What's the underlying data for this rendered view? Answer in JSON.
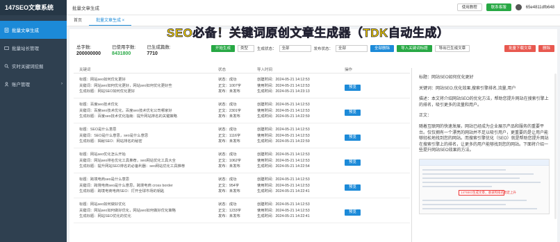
{
  "app": {
    "title": "147SEO文章系统"
  },
  "sidebar": {
    "items": [
      {
        "label": "批量文章生成",
        "active": true
      },
      {
        "label": "批量站长管理",
        "active": false
      },
      {
        "label": "实时关键词挖掘",
        "active": false
      },
      {
        "label": "账户管理",
        "active": false,
        "arrow": "›"
      }
    ]
  },
  "header": {
    "breadcrumb": "批量文章生成",
    "help_label": "使用教程",
    "service_label": "联系客服",
    "username": "65e4811dfb648"
  },
  "tabs": [
    {
      "label": "首页"
    },
    {
      "label": "批量文章生成 ×"
    }
  ],
  "banner": "SEO必备！关键词原创文章生成器（TDK自动生成）",
  "stats": {
    "total_label": "总字数:",
    "total_value": "200000000",
    "used_label": "已使用字数:",
    "used_value": "8431800",
    "generated_label": "已生成篇数:",
    "generated_value": "7710"
  },
  "toolbar": {
    "start_label": "开始生成",
    "status_label": "类型",
    "gen_status_label": "生成状态：",
    "gen_status_value": "全部",
    "pub_status_label": "发布状态：",
    "pub_status_value": "全部",
    "select_all_label": "全部删除",
    "import_label": "导入关键词标题",
    "export_label": "导出已生成文章",
    "export_red_label": "批量下载文章",
    "delete_red_label": "删除"
  },
  "table": {
    "headers": [
      "关键词",
      "状态",
      "导入时间",
      "操作"
    ],
    "op_label": "预览",
    "rows": [
      {
        "title": "标题：网站seo如何优化更好",
        "kw": "关键词：网站seo如何优化更好，网站seo如何优化更好些",
        "gen": "生成标题：网站SEO如何优化更好",
        "s1": "状态：成功",
        "s2": "正文：1007字",
        "s3": "发布：未发布",
        "t1": "创建时间：2024-05-21 14:12:53",
        "t2": "使用时间：2024-05-21 14:12:53",
        "t3": "生成时间：2024-05-21 14:23:13"
      },
      {
        "title": "标题：百度seo技术优化",
        "kw": "关键词：百度seo技术优化，百度seo技术优化公司哪家好",
        "gen": "生成标题：百度seo技术优化指南：提升网站排名的关键策略",
        "s1": "状态：成功",
        "s2": "正文：2301字",
        "s3": "发布：未发布",
        "t1": "创建时间：2024-05-21 14:12:53",
        "t2": "使用时间：2024-05-21 14:12:53",
        "t3": "生成时间：2024-05-21 14:22:59"
      },
      {
        "title": "标题：SEO是什么意思",
        "kw": "关键词：SEO是什么意思，seo是什么意思",
        "gen": "生成标题：揭秘SEO：网站排名的秘密",
        "s1": "状态：成功",
        "s2": "正文：1116字",
        "s3": "发布：未发布",
        "t1": "创建时间：2024-05-21 14:12:53",
        "t2": "使用时间：2024-05-21 14:12:53",
        "t3": "生成时间：2024-05-21 14:22:59"
      },
      {
        "title": "标题：网站seo优化怎么开始",
        "kw": "关键词：网站seo排名优化工具推荐，seo网站优化工具大全",
        "gen": "生成标题：提升网站SEO排名的必备利器：seo网站优化工具推荐",
        "s1": "状态：成功",
        "s2": "正文：1062字",
        "s3": "发布：未发布",
        "t1": "创建时间：2024-05-21 14:12:53",
        "t2": "使用时间：2024-05-21 14:12:53",
        "t3": "生成时间：2024-05-21 14:22:54"
      },
      {
        "title": "标题：跨境电商seo是什么意思",
        "kw": "关键词：跨境电商seo是什么意思，跨境电商 cross border",
        "gen": "生成标题：跨境电商电商SEO：打开全球市场的钥匙",
        "s1": "状态：成功",
        "s2": "正文：954字",
        "s3": "发布：未发布",
        "t1": "创建时间：2024-05-21 14:12:53",
        "t2": "使用时间：2024-05-21 14:12:53",
        "t3": "生成时间：2024-05-21 14:22:41"
      },
      {
        "title": "标题：网站seo如何做好优化",
        "kw": "关键词：网站seo如何做好优化，网站seo如何做好优化策略",
        "gen": "生成标题：网站SEO优化的优化",
        "s1": "状态：成功",
        "s2": "正文：1233字",
        "s3": "发布：未发布",
        "t1": "创建时间：2024-05-21 14:12:53",
        "t2": "使用时间：2024-05-21 14:12:53",
        "t3": "生成时间：2024-05-21 14:22:41"
      }
    ]
  },
  "preview": {
    "title": "标题：网站SEO如何优化更好",
    "keywords": "关键词：网站SEO,优化效果,搜索引擎排名,流量,用户",
    "desc": "描述：本文将介绍网站SEO的优化方法，帮助您提升网站在搜索引擎上的排名，吸引更多的流量和用户。",
    "body_label": "正文：",
    "body": "随着互联网的快速发展，网站已经成为企业展示产品和服务的重要平台。仅仅拥有一个漂亮的网站并不足以吸引用户，更重要的是让用户能够轻松地找到您的网站。而搜索引擎优化（SEO）就是帮助您提升网站在搜索引擎上的排名，让更多的用户能够找到您的网站。下面将介绍一些提升网站SEO效果的方法。",
    "thumb_label": "147SEO生成文章，收录和排名稳定上升"
  }
}
